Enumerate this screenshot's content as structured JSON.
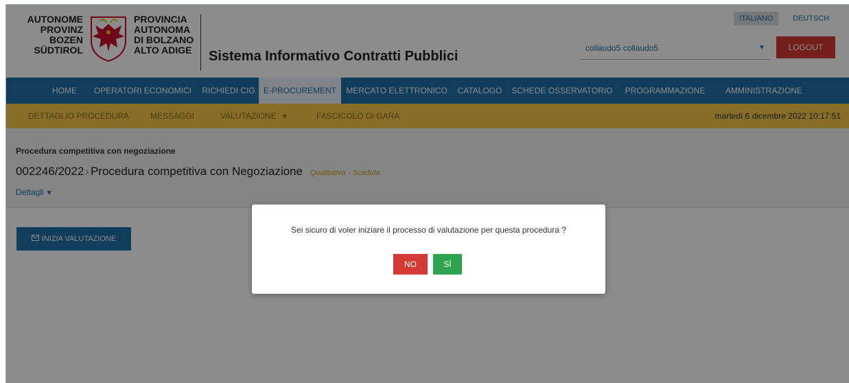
{
  "header": {
    "brand_de": [
      "AUTONOME",
      "PROVINZ",
      "BOZEN",
      "SÜDTIROL"
    ],
    "brand_it": [
      "PROVINCIA",
      "AUTONOMA",
      "DI BOLZANO",
      "ALTO ADIGE"
    ],
    "app_title": "Sistema Informativo Contratti Pubblici",
    "languages": {
      "italian": "ITALIANO",
      "german": "DEUTSCH"
    },
    "user_select_value": "collaudo5 collaudo5",
    "logout_label": "LOGOUT"
  },
  "main_nav": [
    "HOME",
    "OPERATORI ECONOMICI",
    "RICHIEDI CIG",
    "E-PROCUREMENT",
    "MERCATO ELETTRONICO",
    "CATALOGO",
    "SCHEDE OSSERVATORIO",
    "PROGRAMMAZIONE",
    "AMMINISTRAZIONE"
  ],
  "sub_nav": {
    "items": [
      "DETTAGLIO PROCEDURA",
      "MESSAGGI",
      "VALUTAZIONE",
      "FASCICOLO DI GARA"
    ],
    "datetime": "martedì 6 dicembre 2022 10:17:51"
  },
  "procedure": {
    "type_label": "Procedura competitiva con negoziazione",
    "code": "002246/2022",
    "title": "Procedura competitiva con Negoziazione",
    "status": "Qualitativa - Scaduta",
    "details_link": "Dettagli"
  },
  "actions": {
    "start_evaluation": "INIZIA VALUTAZIONE"
  },
  "modal": {
    "message": "Sei sicuro di voler iniziare il processo di valutazione per questa procedura ?",
    "no_label": "NO",
    "yes_label": "SÌ"
  },
  "colors": {
    "primary_blue": "#1f6fa8",
    "subnav_yellow": "#f5c84a",
    "danger_red": "#d23a33",
    "success_green": "#2ea44f",
    "status_gold": "#c9a51b"
  }
}
